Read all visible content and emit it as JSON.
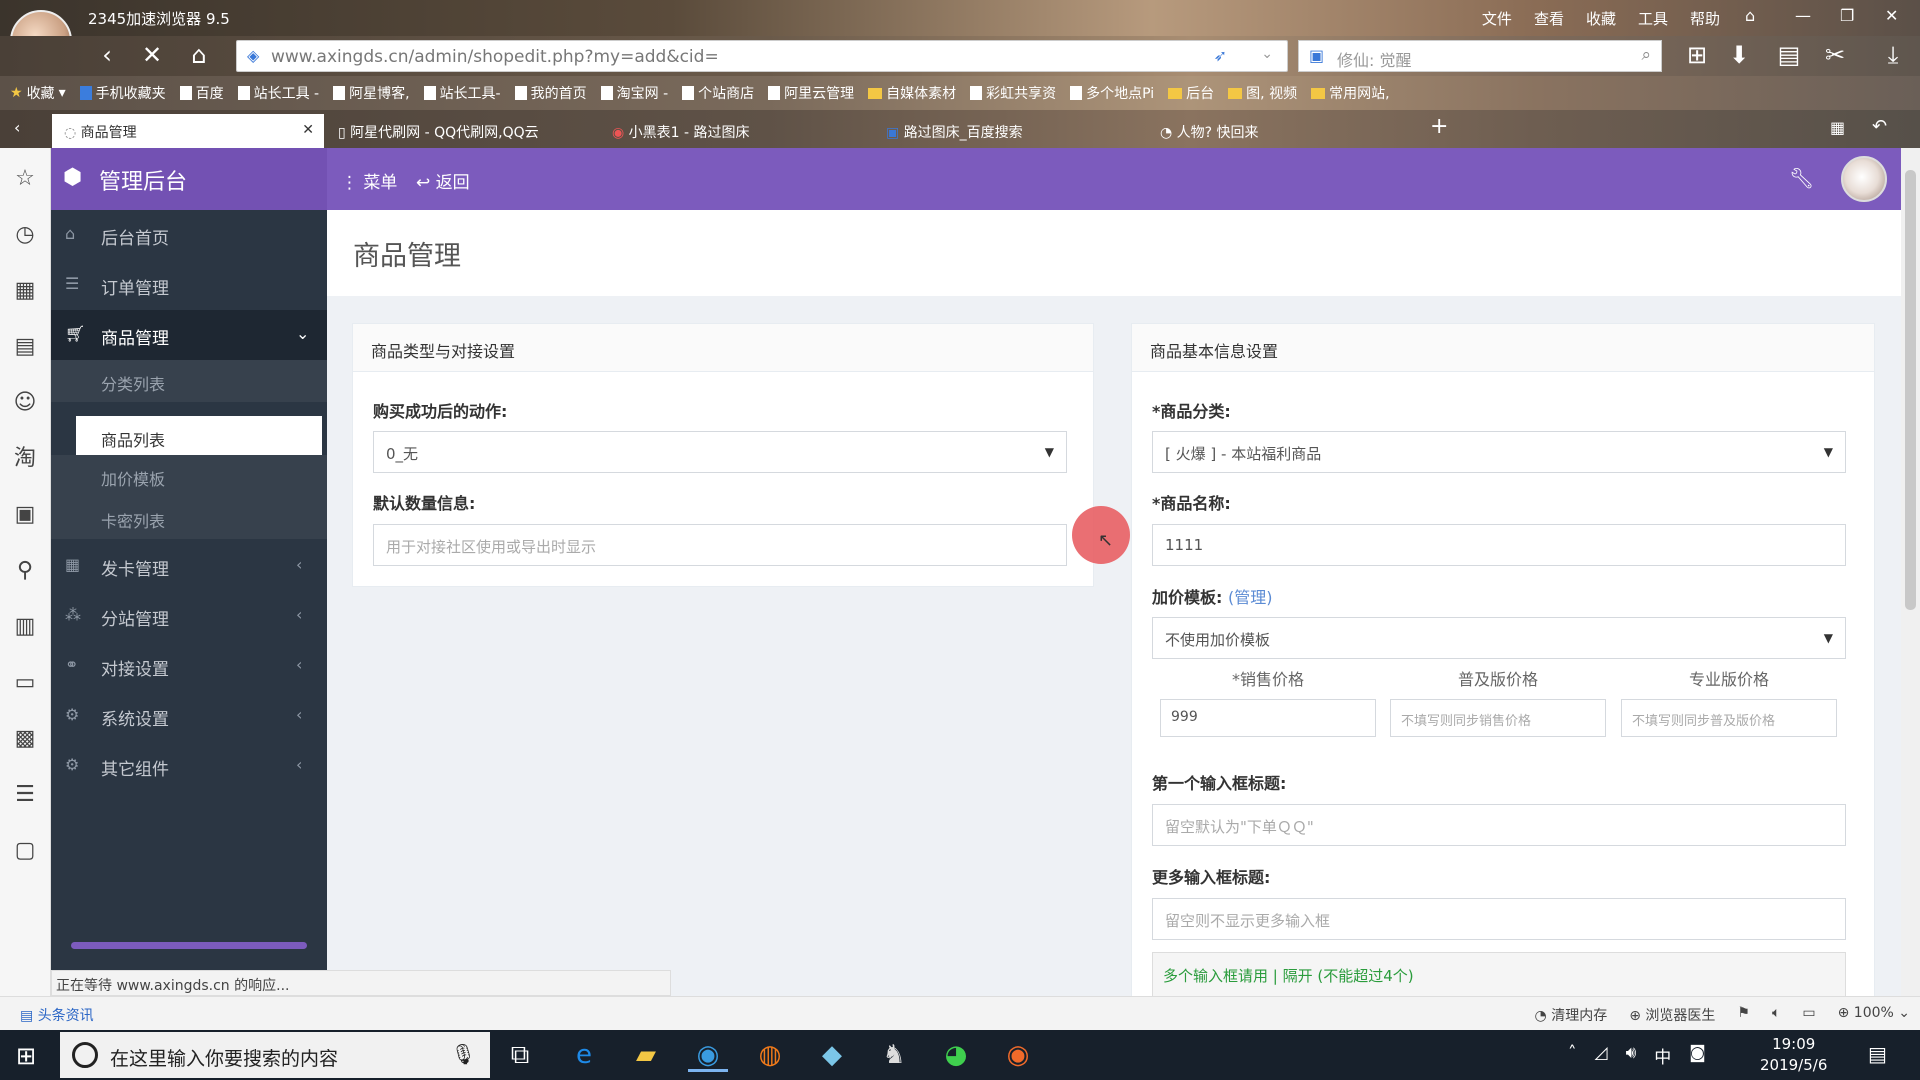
{
  "browser": {
    "title": "2345加速浏览器 9.5",
    "menu": [
      "文件",
      "查看",
      "收藏",
      "工具",
      "帮助"
    ],
    "url": "www.axingds.cn/admin/shopedit.php?my=add&cid=",
    "search": "修仙: 觉醒",
    "bookmarks": [
      "收藏",
      "手机收藏夹",
      "百度",
      "站长工具 -",
      "阿星博客,",
      "站长工具-",
      "我的首页",
      "淘宝网 -",
      "个站商店",
      "阿里云管理",
      "自媒体素材",
      "彩虹共享资",
      "多个地点Pi",
      "后台",
      "图, 视频",
      "常用网站,"
    ],
    "tabs": [
      "商品管理",
      "阿星代刷网 - QQ代刷网,QQ云",
      "小黑表1 - 路过图床",
      "路过图床_百度搜索",
      "人物? 快回来"
    ],
    "status_text": "正在等待 www.axingds.cn 的响应...",
    "news": "头条资讯",
    "bottom_right": [
      "清理内存",
      "浏览器医生",
      "100%"
    ]
  },
  "admin": {
    "brand": "管理后台",
    "menu_btn": "菜单",
    "back_btn": "返回",
    "side": [
      {
        "label": "后台首页",
        "icon": "home-icon"
      },
      {
        "label": "订单管理",
        "icon": "list-icon"
      },
      {
        "label": "商品管理",
        "icon": "cart-icon"
      },
      {
        "label": "发卡管理",
        "icon": "grid-icon"
      },
      {
        "label": "分站管理",
        "icon": "sitemap-icon"
      },
      {
        "label": "对接设置",
        "icon": "link-icon"
      },
      {
        "label": "系统设置",
        "icon": "gear-icon"
      },
      {
        "label": "其它组件",
        "icon": "gears-icon"
      }
    ],
    "sub": [
      "分类列表",
      "商品列表",
      "加价模板",
      "卡密列表"
    ]
  },
  "page": {
    "title": "商品管理",
    "left_panel": {
      "title": "商品类型与对接设置",
      "action_label": "购买成功后的动作:",
      "action_value": "0_无",
      "qty_label": "默认数量信息:",
      "qty_placeholder": "用于对接社区使用或导出时显示"
    },
    "right_panel": {
      "title": "商品基本信息设置",
      "category_label": "*商品分类:",
      "category_value": "[ 火爆 ] - 本站福利商品",
      "name_label": "*商品名称:",
      "name_value": "1111",
      "markup_label": "加价模板:",
      "markup_link": "(管理)",
      "markup_value": "不使用加价模板",
      "price_headers": [
        "*销售价格",
        "普及版价格",
        "专业版价格"
      ],
      "sale_price": "999",
      "basic_placeholder": "不填写则同步销售价格",
      "pro_placeholder": "不填写则同步普及版价格",
      "first_input_label": "第一个输入框标题:",
      "first_input_placeholder": "留空默认为\"下单ＱＱ\"",
      "more_input_label": "更多输入框标题:",
      "more_input_placeholder": "留空则不显示更多输入框",
      "hint": "多个输入框请用 | 隔开 (不能超过4个)"
    }
  },
  "taskbar": {
    "search": "在这里输入你要搜索的内容",
    "time": "19:09",
    "date": "2019/5/6",
    "ime": "中"
  }
}
